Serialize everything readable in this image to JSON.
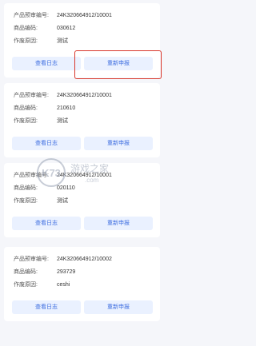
{
  "labels": {
    "record_no": "产品预审编号:",
    "product_code": "商品编码:",
    "void_reason": "作废原因:",
    "view_log": "查看日志",
    "resubmit": "重新申报"
  },
  "records": [
    {
      "record_no": "24K320664912/10001",
      "product_code": "030612",
      "void_reason": "测试"
    },
    {
      "record_no": "24K320664912/10001",
      "product_code": "210610",
      "void_reason": "测试"
    },
    {
      "record_no": "24K320664912/10001",
      "product_code": "020110",
      "void_reason": "测试"
    },
    {
      "record_no": "24K320664912/10002",
      "product_code": "293729",
      "void_reason": "ceshi"
    }
  ],
  "watermark": {
    "text": "K73 游戏之家 .com"
  },
  "colors": {
    "accent": "#3d6de0",
    "button_bg": "#eaf1ff",
    "highlight": "#d9372b",
    "page_bg": "#f5f6fa"
  }
}
